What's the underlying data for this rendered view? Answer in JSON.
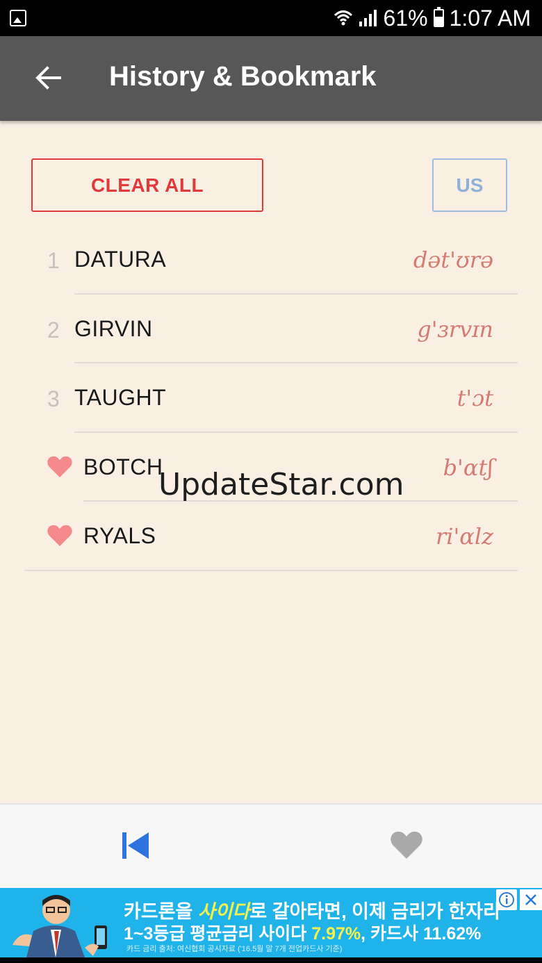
{
  "status_bar": {
    "battery": "61%",
    "battery_level": 0.61,
    "time": "1:07 AM"
  },
  "app_bar": {
    "title": "History & Bookmark",
    "back_icon": "arrow-left-icon"
  },
  "actions": {
    "clear_all_label": "CLEAR ALL",
    "accent_label": "US"
  },
  "colors": {
    "app_bar": "#575757",
    "background": "#f9efe3",
    "clear_all": "#e23a3a",
    "accent_toggle": "#9cbde0",
    "ipa": "#d27c72",
    "heart": "#f48a8a",
    "active_tab": "#2e73e0",
    "inactive_tab": "#a9a9a9"
  },
  "history": [
    {
      "number": "1",
      "word": "DATURA",
      "ipa": "dət'ʊrə",
      "bookmarked": false
    },
    {
      "number": "2",
      "word": "GIRVIN",
      "ipa": "g'ɜrvɪn",
      "bookmarked": false
    },
    {
      "number": "3",
      "word": "TAUGHT",
      "ipa": "t'ɔt",
      "bookmarked": false
    },
    {
      "number": "",
      "word": "BOTCH",
      "ipa": "b'ɑtʃ",
      "bookmarked": true
    },
    {
      "number": "",
      "word": "RYALS",
      "ipa": "ri'ɑlz",
      "bookmarked": true
    }
  ],
  "watermark": "UpdateStar.com",
  "bottom_nav": {
    "history_icon": "skip-previous-icon",
    "bookmark_icon": "heart-icon"
  },
  "ad": {
    "line1_a": "카드론을 ",
    "line1_highlight": "사이다",
    "line1_b": "로 갈아타면, 이제 금리가 한자리",
    "line2_a": "1~3등급 평균금리 사이다 ",
    "line2_highlight": "7.97%",
    "line2_b": ", 카드사 11.62%",
    "line3": "카드 금리 출처: 여신협회 공시자료 ('16.5월 말 7개 전업카드사 기준)"
  }
}
